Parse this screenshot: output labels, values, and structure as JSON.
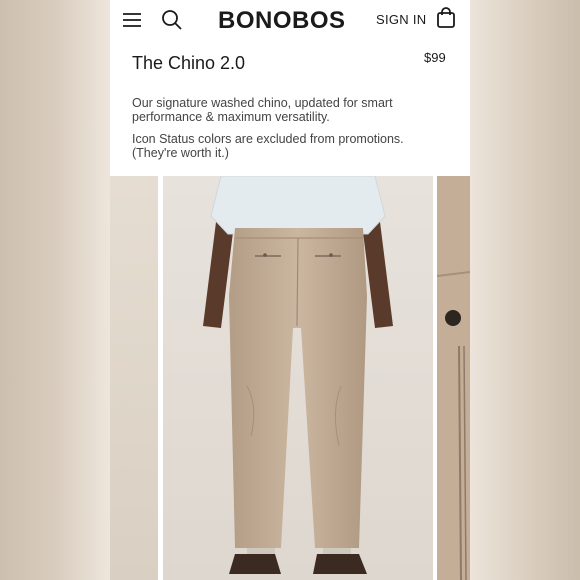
{
  "header": {
    "brand": "BONOBOS",
    "sign_in_label": "SIGN IN",
    "icons": [
      "menu-icon",
      "search-icon",
      "shopping-bag-icon"
    ]
  },
  "product": {
    "title": "The Chino 2.0",
    "price": "$99",
    "description": "Our signature washed chino, updated for smart performance & maximum versatility.",
    "note": "Icon Status colors are excluded from promotions. (They're worth it.)"
  },
  "colors": {
    "text": "#1a1a1a",
    "khaki": "#c8b39d",
    "shirt": "#dfe7ec",
    "shoe": "#3a2a22"
  }
}
